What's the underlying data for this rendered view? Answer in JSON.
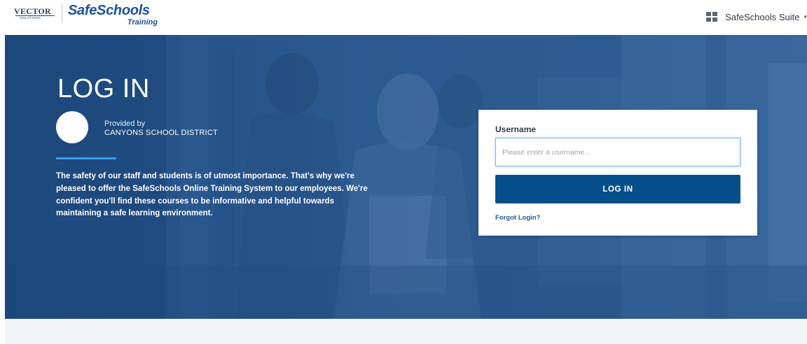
{
  "header": {
    "vector_logo_text": "VECTOR",
    "vector_logo_sub": "SOLUTIONS",
    "app_name": "SafeSchools",
    "app_subtitle": "Training",
    "suite_menu_label": "SafeSchools Suite",
    "suite_icon": "grid-icon",
    "suite_caret_icon": "chevron-down-icon"
  },
  "hero": {
    "heading": "LOG IN",
    "provided_by_label": "Provided by",
    "district_name": "CANYONS SCHOOL DISTRICT",
    "description": "The safety of our staff and students is of utmost importance. That's why we're pleased to offer the SafeSchools Online Training System to our employees. We're confident you'll find these courses to be informative and helpful towards maintaining a safe learning environment."
  },
  "login_form": {
    "username_label": "Username",
    "username_value": "",
    "username_placeholder": "Please enter a username...",
    "submit_label": "LOG IN",
    "forgot_link": "Forgot Login?"
  },
  "colors": {
    "brand_blue": "#1e4f9a",
    "button_blue": "#064f8b",
    "accent_bar": "#3d9be9",
    "hero_tint": "#2c5e97"
  }
}
